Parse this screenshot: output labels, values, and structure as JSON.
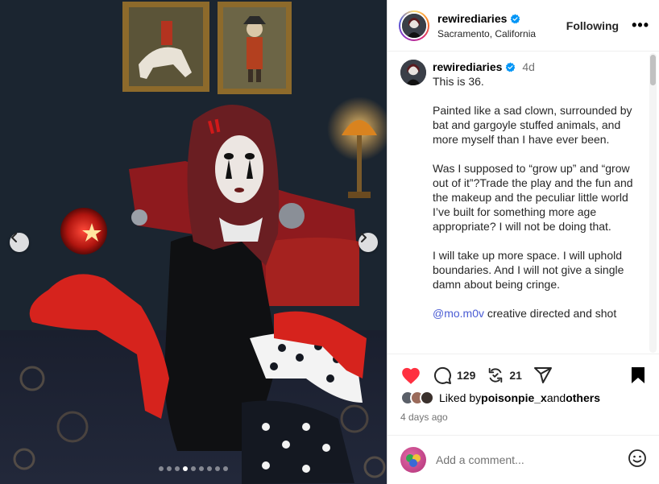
{
  "post": {
    "username": "rewirediaries",
    "location": "Sacramento, California",
    "follow_label": "Following",
    "more_label": "•••",
    "time_ago": "4d",
    "caption": {
      "p1": "This is 36.",
      "p2": "Painted like a sad clown, surrounded by bat and gargoyle stuffed animals, and more myself than I have ever been.",
      "p3": "Was I supposed to “grow up” and “grow out of it”?Trade the play and the fun and the makeup and the peculiar little world I’ve built for something more age appropriate? I will not be doing that.",
      "p4": "I will take up more space. I will uphold boundaries. And I will not give a single damn about being cringe.",
      "mention": "@mo.m0v",
      "p5_rest": " creative directed and shot"
    }
  },
  "actions": {
    "comment_count": "129",
    "repost_count": "21"
  },
  "likes": {
    "prefix": "Liked by ",
    "user": "poisonpie_x",
    "middle": " and ",
    "others": "others"
  },
  "date_text": "4 days ago",
  "comment_box": {
    "placeholder": "Add a comment..."
  },
  "carousel": {
    "slide_count": 9,
    "active_index": 3
  },
  "icons": {
    "verified": "verified-badge-icon",
    "like": "heart-icon",
    "comment": "comment-icon",
    "repost": "repost-icon",
    "share": "share-icon",
    "save": "bookmark-icon",
    "emoji": "emoji-icon"
  },
  "colors": {
    "heart": "#ff3040",
    "verified": "#0095f6",
    "mention": "#4a5cd4"
  }
}
